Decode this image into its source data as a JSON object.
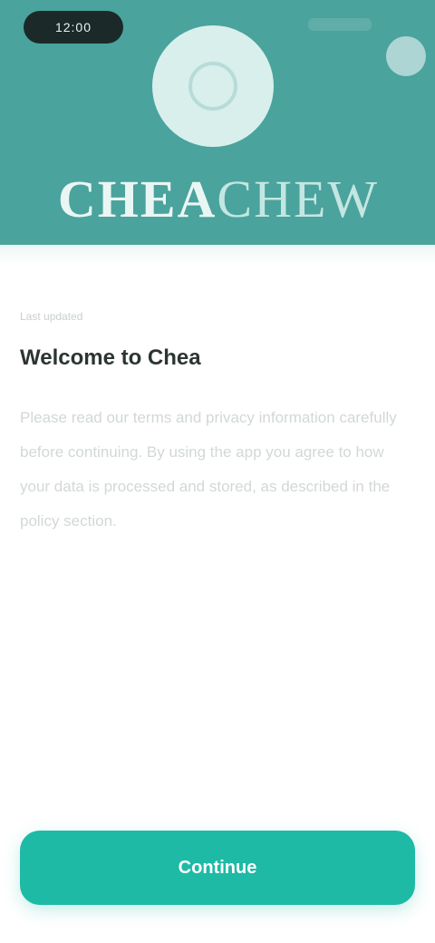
{
  "status": {
    "time": "12:00"
  },
  "header": {
    "brand_strong": "CHEA",
    "brand_light": "CHEW",
    "colors": {
      "header_bg": "#4aa39d",
      "logo_bg": "#d9efec",
      "accent": "#1ebaa6"
    }
  },
  "content": {
    "kicker": "Last updated",
    "title": "Welcome to Chea",
    "body": "Please read our terms and privacy information carefully before continuing. By using the app you agree to how your data is processed and stored, as described in the policy section."
  },
  "cta": {
    "label": "Continue"
  }
}
